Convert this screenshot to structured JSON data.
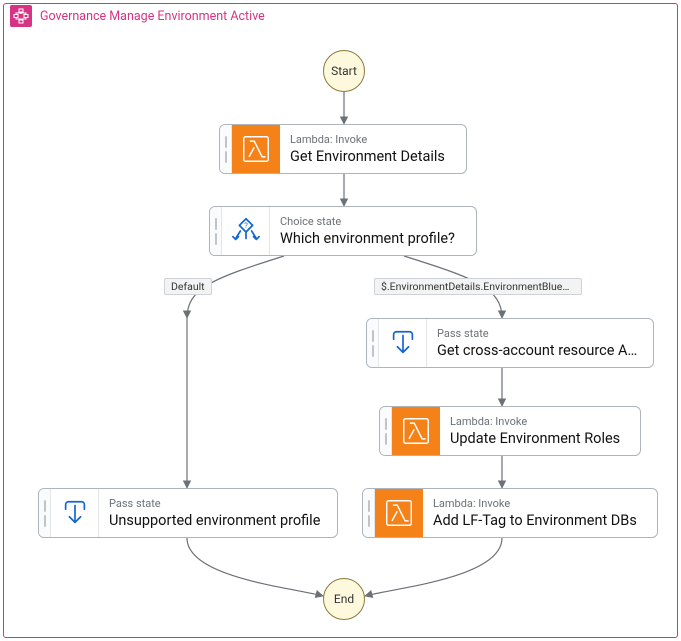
{
  "header": {
    "title": "Governance Manage Environment Active",
    "icon": "step-functions-icon"
  },
  "nodes": {
    "start": {
      "label": "Start"
    },
    "end": {
      "label": "End"
    },
    "getEnv": {
      "kind": "Lambda: Invoke",
      "name": "Get Environment Details"
    },
    "choice": {
      "kind": "Choice state",
      "name": "Which environment profile?"
    },
    "crossAcct": {
      "kind": "Pass state",
      "name": "Get cross-account resource ARNs"
    },
    "updateRoles": {
      "kind": "Lambda: Invoke",
      "name": "Update Environment Roles"
    },
    "addLf": {
      "kind": "Lambda: Invoke",
      "name": "Add LF-Tag to Environment DBs"
    },
    "unsupported": {
      "kind": "Pass state",
      "name": "Unsupported environment profile"
    }
  },
  "edgeLabels": {
    "default": "Default",
    "match": "$.EnvironmentDetails.EnvironmentBluep…"
  }
}
